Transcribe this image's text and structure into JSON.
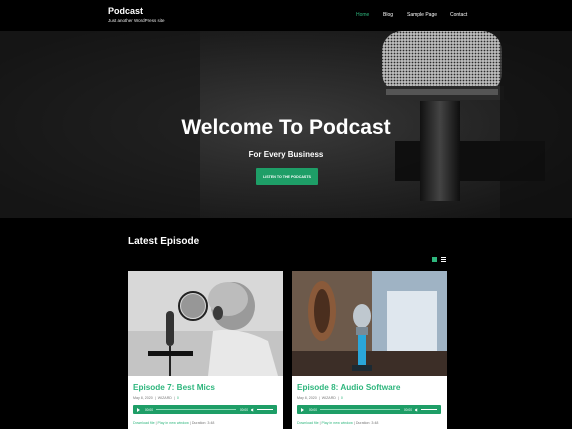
{
  "site": {
    "title": "Podcast",
    "tagline": "Just another WordPress site"
  },
  "nav": {
    "items": [
      {
        "label": "Home",
        "active": true
      },
      {
        "label": "Blog",
        "active": false
      },
      {
        "label": "Sample Page",
        "active": false
      },
      {
        "label": "Contact",
        "active": false
      }
    ]
  },
  "hero": {
    "title": "Welcome To Podcast",
    "subtitle": "For Every Business",
    "button_label": "LISTEN TO THE PODCASTS"
  },
  "episodes": {
    "section_title": "Latest Episode",
    "items": [
      {
        "title": "Episode 7: Best Mics",
        "date": "May 8, 2020",
        "category": "WIZARD",
        "comments": "0",
        "time_start": "00:00",
        "time_end": "00:00",
        "download": "Download file",
        "play_new": "Play in new window",
        "duration": "Duration: 3:48"
      },
      {
        "title": "Episode 8: Audio Software",
        "date": "May 8, 2020",
        "category": "WIZARD",
        "comments": "0",
        "time_start": "00:00",
        "time_end": "00:00",
        "download": "Download file",
        "play_new": "Play in new window",
        "duration": "Duration: 3:48"
      }
    ]
  },
  "colors": {
    "accent": "#2eb67d",
    "button": "#1e9e67",
    "background": "#000000"
  }
}
